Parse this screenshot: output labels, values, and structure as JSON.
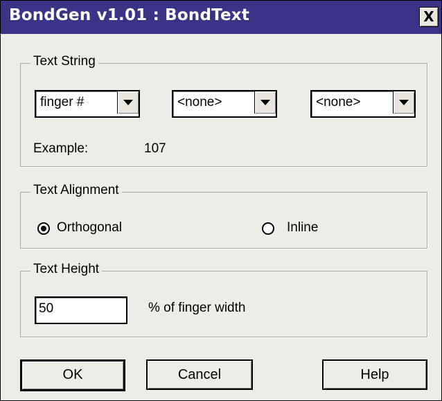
{
  "window": {
    "title": "BondGen v1.01 : BondText",
    "close_glyph": "X",
    "close_icon": "close-icon"
  },
  "text_string": {
    "legend": "Text String",
    "combo1_value": "finger #",
    "combo2_value": "<none>",
    "combo3_value": "<none>",
    "example_label": "Example:",
    "example_value": "107"
  },
  "text_alignment": {
    "legend": "Text Alignment",
    "options": [
      {
        "label": "Orthogonal",
        "selected": true
      },
      {
        "label": "Inline",
        "selected": false
      }
    ]
  },
  "text_height": {
    "legend": "Text Height",
    "value": "50",
    "unit_label": "% of finger width"
  },
  "buttons": {
    "ok": "OK",
    "cancel": "Cancel",
    "help": "Help"
  }
}
